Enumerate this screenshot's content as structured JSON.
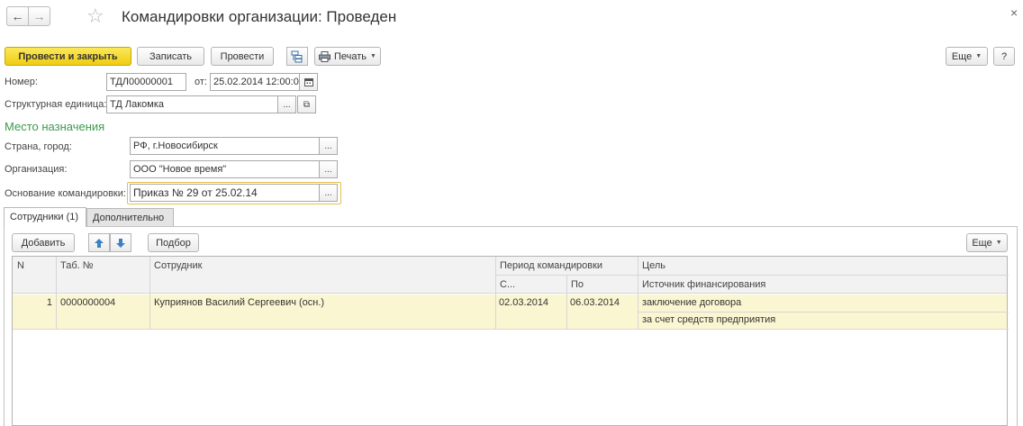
{
  "window": {
    "title": "Командировки организации: Проведен",
    "back_icon": "arrow-left-icon",
    "forward_icon": "arrow-right-icon",
    "close_icon": "close-icon"
  },
  "toolbar": {
    "post_and_close": "Провести и закрыть",
    "save": "Записать",
    "post": "Провести",
    "print": "Печать",
    "more": "Еще",
    "help": "?"
  },
  "form": {
    "number_label": "Номер:",
    "number_value": "ТДЛ00000001",
    "date_label": "от:",
    "date_value": "25.02.2014 12:00:0",
    "unit_label": "Структурная единица:",
    "unit_value": "ТД Лакомка",
    "destination_section": "Место назначения",
    "country_label": "Страна, город:",
    "country_value": "РФ, г.Новосибирск",
    "org_label": "Организация:",
    "org_value": "ООО \"Новое время\"",
    "basis_label": "Основание командировки:",
    "basis_value": "Приказ № 29 от 25.02.14",
    "pick_symbol": "...",
    "open_symbol": "⧉"
  },
  "tabs": [
    {
      "label": "Сотрудники (1)",
      "active": true
    },
    {
      "label": "Дополнительно",
      "active": false
    }
  ],
  "table_toolbar": {
    "add": "Добавить",
    "pick": "Подбор",
    "more": "Еще"
  },
  "table": {
    "headers": {
      "n": "N",
      "tab_no": "Таб. №",
      "employee": "Сотрудник",
      "period": "Период командировки",
      "from": "С...",
      "to": "По",
      "goal": "Цель",
      "funding": "Источник финансирования"
    },
    "rows": [
      {
        "n": "1",
        "tab_no": "0000000004",
        "employee": "Куприянов Василий Сергеевич (осн.)",
        "from": "02.03.2014",
        "to": "06.03.2014",
        "goal": "заключение договора",
        "funding": "за счет средств предприятия"
      }
    ]
  },
  "colors": {
    "primary_button": "#f0cd12",
    "section_heading": "#3c9a4a",
    "selected_row": "#fbf6d2",
    "focus_border": "#e4c04a"
  }
}
